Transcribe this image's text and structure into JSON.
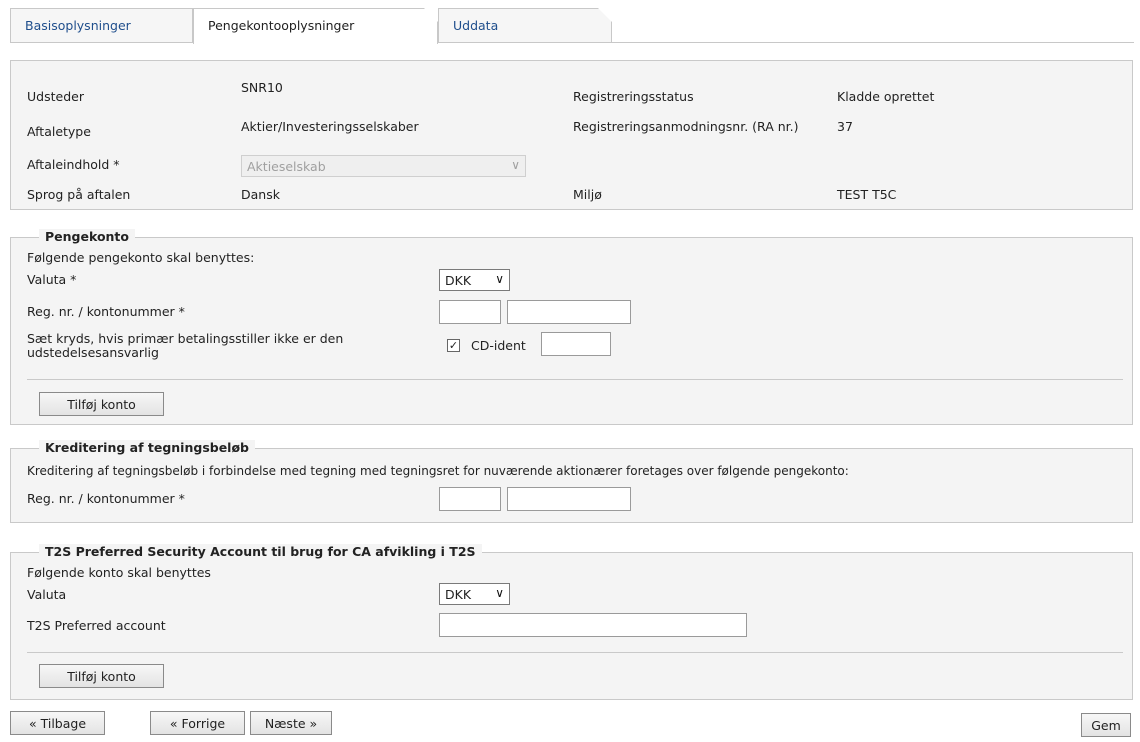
{
  "tabs": [
    "Basisoplysninger",
    "Pengekontooplysninger",
    "Uddata"
  ],
  "info": {
    "udsteder_label": "Udsteder",
    "udsteder_value": "SNR10",
    "aftaletype_label": "Aftaletype",
    "aftaletype_value": "Aktier/Investeringsselskaber",
    "aftaleindhold_label": "Aftaleindhold *",
    "aftaleindhold_value": "Aktieselskab",
    "sprog_label": "Sprog på aftalen",
    "sprog_value": "Dansk",
    "regstatus_label": "Registreringsstatus",
    "regstatus_value": "Kladde oprettet",
    "ranr_label": "Registreringsanmodningsnr. (RA nr.)",
    "ranr_value": "37",
    "miljo_label": "Miljø",
    "miljo_value": "TEST T5C"
  },
  "pengekonto": {
    "legend": "Pengekonto",
    "intro": "Følgende pengekonto skal benyttes:",
    "valuta_label": "Valuta *",
    "valuta_value": "DKK",
    "regnr_label": "Reg. nr. / kontonummer *",
    "kryds_label": "Sæt kryds, hvis primær betalingsstiller ikke er den udstedelsesansvarlig",
    "checkbox_checked": true,
    "cdident_label": "CD-ident",
    "add_button": "Tilføj konto"
  },
  "kreditering": {
    "legend": "Kreditering af tegningsbeløb",
    "intro": "Kreditering af tegningsbeløb i forbindelse med tegning med tegningsret for nuværende aktionærer foretages over følgende pengekonto:",
    "regnr_label": "Reg. nr. / kontonummer *"
  },
  "t2s": {
    "legend": "T2S Preferred Security Account til brug for CA afvikling i T2S",
    "intro": "Følgende konto skal benyttes",
    "valuta_label": "Valuta",
    "valuta_value": "DKK",
    "account_label": "T2S Preferred account",
    "add_button": "Tilføj konto"
  },
  "footer": {
    "tilbage": "« Tilbage",
    "forrige": "« Forrige",
    "naeste": "Næste »",
    "gem": "Gem"
  }
}
